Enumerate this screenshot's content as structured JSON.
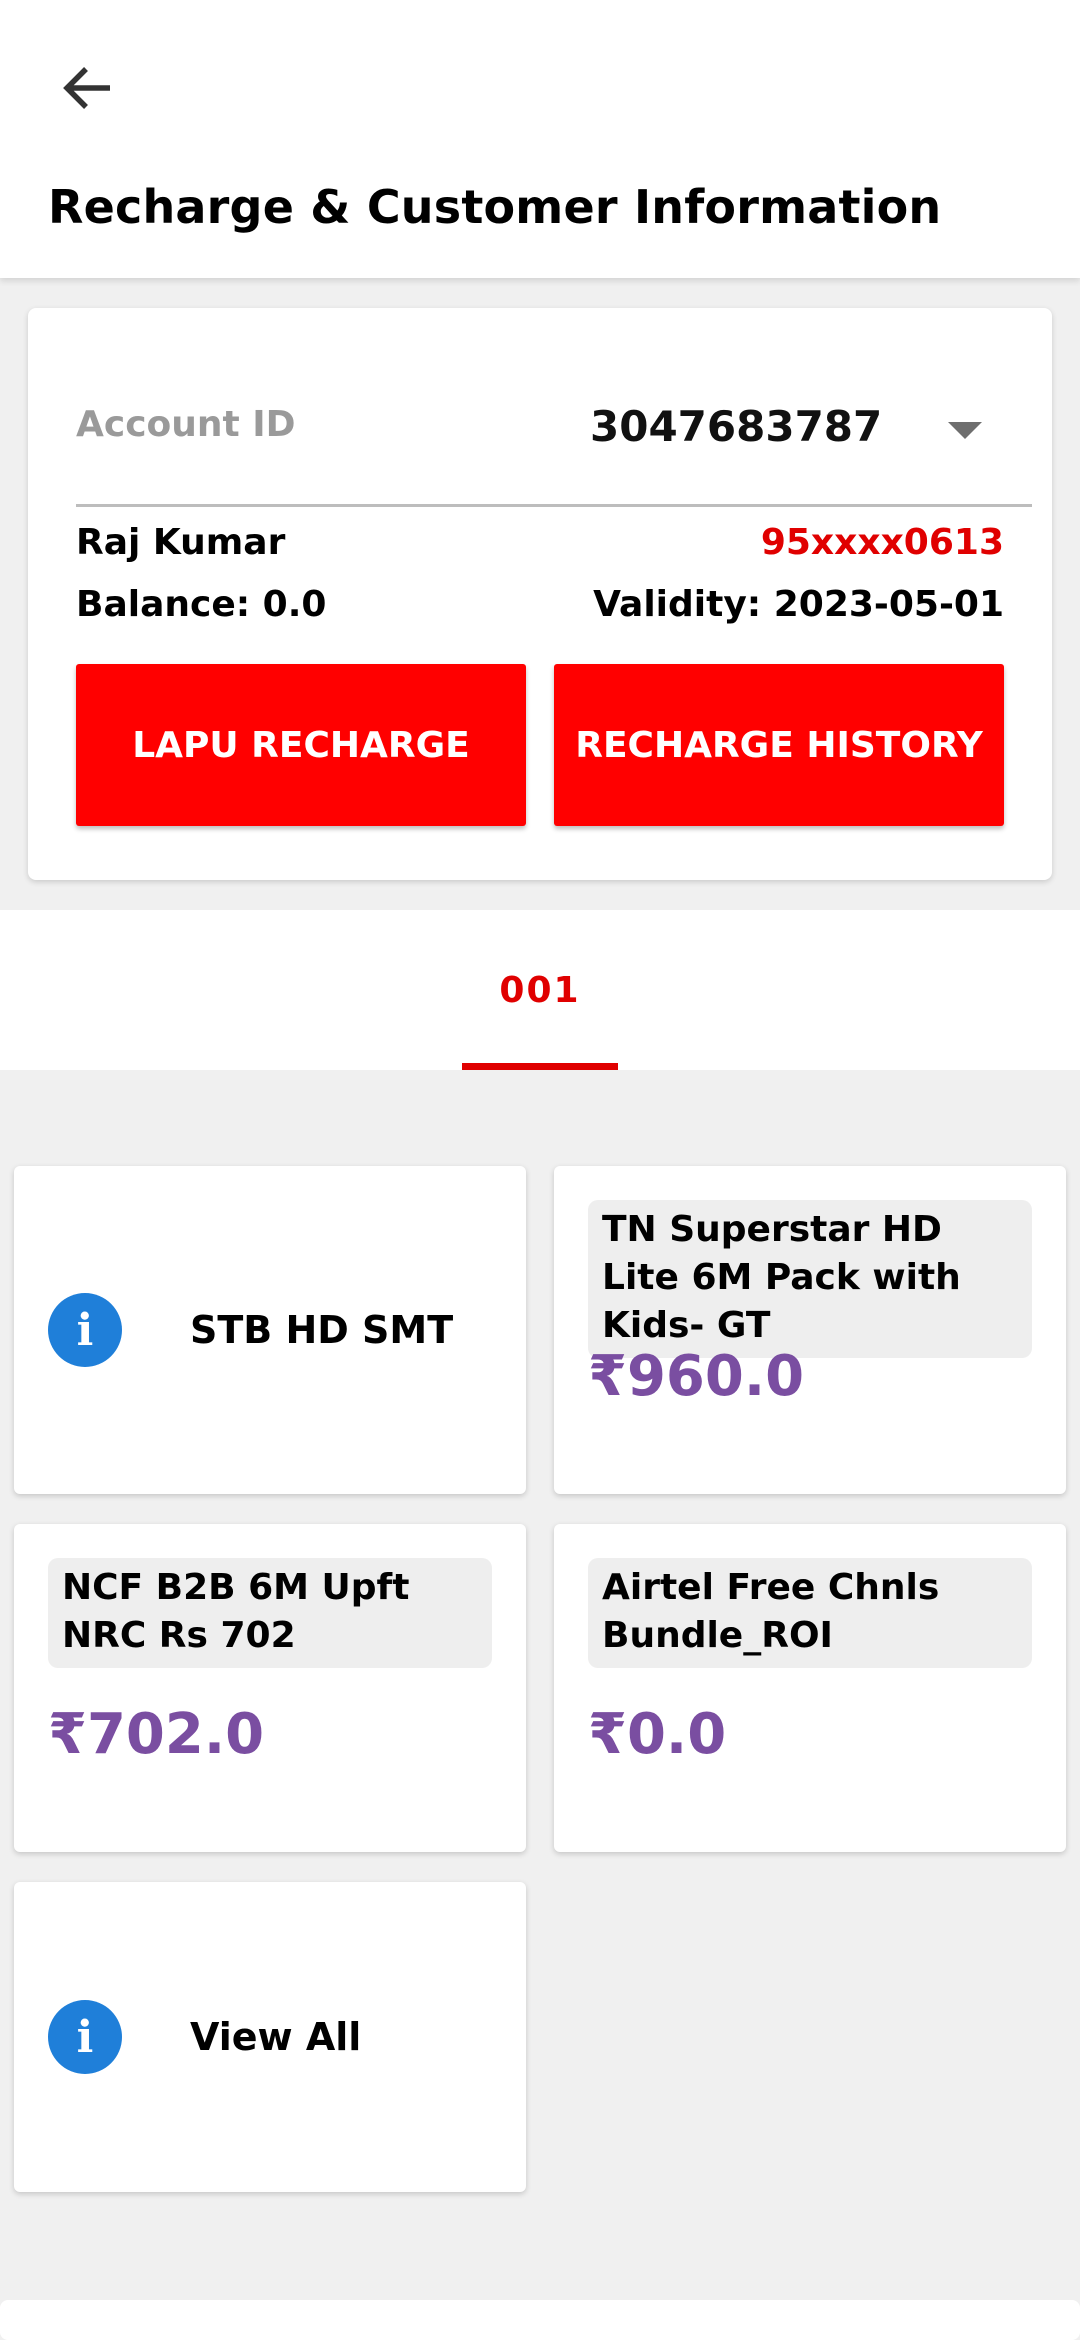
{
  "header": {
    "back_icon": "arrow-back-icon",
    "title": "Recharge & Customer Information"
  },
  "account": {
    "label": "Account ID",
    "selected_id": "3047683787",
    "dropdown_icon": "dropdown-arrow-icon",
    "customer_name": "Raj Kumar",
    "phone": "95xxxx0613",
    "balance": "Balance: 0.0",
    "validity": "Validity: 2023-05-01",
    "lapu_button": "LAPU RECHARGE",
    "history_button": "RECHARGE HISTORY"
  },
  "tabs": [
    {
      "label": "001",
      "active": true
    }
  ],
  "tiles": {
    "stb": {
      "icon": "info-icon",
      "glyph": "i",
      "label": "STB HD SMT"
    },
    "packs": [
      {
        "name": "TN Superstar HD Lite 6M Pack with Kids- GT",
        "price": "₹960.0"
      },
      {
        "name": "NCF B2B 6M Upft NRC Rs 702",
        "price": "₹702.0"
      },
      {
        "name": "Airtel Free Chnls Bundle_ROI",
        "price": "₹0.0"
      }
    ],
    "view_all": {
      "icon": "info-icon",
      "glyph": "i",
      "label": "View All"
    }
  },
  "colors": {
    "accent_red": "#ff0000",
    "phone_red": "#e00000",
    "price_purple": "#7a4ea1",
    "info_blue": "#1f7fd9",
    "background": "#f0f0f0"
  }
}
